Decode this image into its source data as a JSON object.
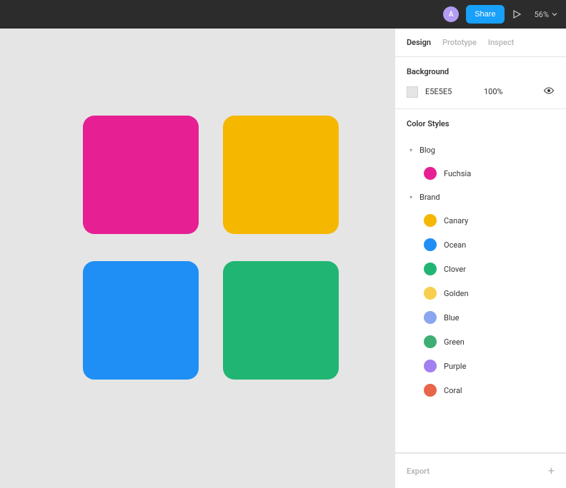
{
  "header": {
    "avatar_initial": "A",
    "share_label": "Share",
    "zoom_label": "56%"
  },
  "canvas": {
    "background": "#e5e5e5",
    "shapes": [
      {
        "color": "#e61f93"
      },
      {
        "color": "#f5b700"
      },
      {
        "color": "#1f8ff5"
      },
      {
        "color": "#21b573"
      }
    ]
  },
  "panel": {
    "tabs": [
      {
        "label": "Design",
        "active": true
      },
      {
        "label": "Prototype",
        "active": false
      },
      {
        "label": "Inspect",
        "active": false
      }
    ],
    "background": {
      "title": "Background",
      "hex": "E5E5E5",
      "opacity": "100%"
    },
    "color_styles": {
      "title": "Color Styles",
      "groups": [
        {
          "name": "Blog",
          "items": [
            {
              "name": "Fuchsia",
              "color": "#e61f93"
            }
          ]
        },
        {
          "name": "Brand",
          "items": [
            {
              "name": "Canary",
              "color": "#f5b700"
            },
            {
              "name": "Ocean",
              "color": "#1f8ff5"
            },
            {
              "name": "Clover",
              "color": "#21b573"
            },
            {
              "name": "Golden",
              "color": "#f7cf4d"
            },
            {
              "name": "Blue",
              "color": "#8aa6f0"
            },
            {
              "name": "Green",
              "color": "#3fae74"
            },
            {
              "name": "Purple",
              "color": "#a37ff0"
            },
            {
              "name": "Coral",
              "color": "#e8654a"
            }
          ]
        }
      ]
    },
    "export_title": "Export"
  }
}
